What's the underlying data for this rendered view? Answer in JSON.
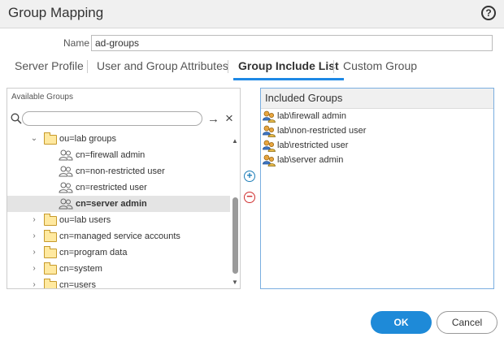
{
  "window": {
    "title": "Group Mapping",
    "help_label": "?"
  },
  "form": {
    "name_label": "Name",
    "name_value": "ad-groups"
  },
  "tabs": [
    {
      "label": "Server Profile",
      "active": false
    },
    {
      "label": "User and Group Attributes",
      "active": false
    },
    {
      "label": "Group Include List",
      "active": true
    },
    {
      "label": "Custom Group",
      "active": false
    }
  ],
  "available": {
    "title": "Available Groups",
    "search_value": "",
    "tree": [
      {
        "label": "ou=lab groups",
        "type": "folder",
        "expanded": true
      },
      {
        "label": "cn=firewall admin",
        "type": "group"
      },
      {
        "label": "cn=non-restricted user",
        "type": "group"
      },
      {
        "label": "cn=restricted user",
        "type": "group"
      },
      {
        "label": "cn=server admin",
        "type": "group",
        "selected": true
      },
      {
        "label": "ou=lab users",
        "type": "folder",
        "expanded": false
      },
      {
        "label": "cn=managed service accounts",
        "type": "folder",
        "expanded": false
      },
      {
        "label": "cn=program data",
        "type": "folder",
        "expanded": false
      },
      {
        "label": "cn=system",
        "type": "folder",
        "expanded": false
      },
      {
        "label": "cn=users",
        "type": "folder",
        "expanded": false
      }
    ]
  },
  "included": {
    "title": "Included Groups",
    "items": [
      "lab\\firewall admin",
      "lab\\non-restricted user",
      "lab\\restricted user",
      "lab\\server admin"
    ]
  },
  "buttons": {
    "ok": "OK",
    "cancel": "Cancel"
  },
  "colors": {
    "accent": "#1e88e5",
    "ok_bg": "#1e8ad8",
    "remove": "#d03030",
    "add": "#1e7eb8",
    "selected_row": "#e4e4e4"
  },
  "icons": {
    "help": "help-icon",
    "search": "search-icon",
    "arrow": "arrow-right-icon",
    "clear": "close-icon",
    "folder": "folder-icon",
    "group": "group-icon",
    "included_group": "user-group-icon",
    "add": "add-circle-icon",
    "remove": "remove-circle-icon"
  }
}
